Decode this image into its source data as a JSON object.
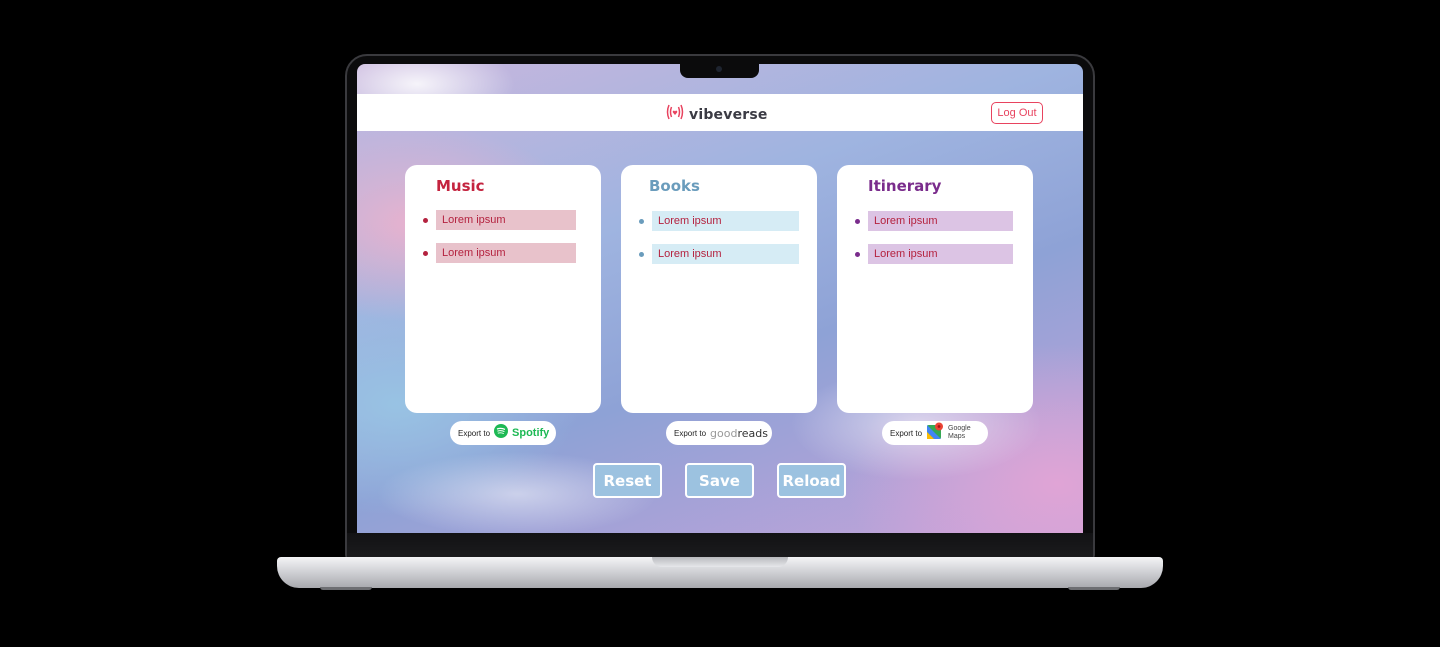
{
  "app": {
    "brand": "vibeverse",
    "logout_label": "Log Out"
  },
  "cards": {
    "music": {
      "title": "Music",
      "items": [
        "Lorem ipsum",
        "Lorem ipsum"
      ]
    },
    "books": {
      "title": "Books",
      "items": [
        "Lorem ipsum",
        "Lorem ipsum"
      ]
    },
    "itinerary": {
      "title": "Itinerary",
      "items": [
        "Lorem ipsum",
        "Lorem ipsum"
      ]
    }
  },
  "exports": {
    "spotify": {
      "label": "Export to",
      "service": "Spotify"
    },
    "goodreads": {
      "label": "Export to",
      "service_light": "good",
      "service_dark": "reads"
    },
    "google_maps": {
      "label": "Export to",
      "service_line1": "Google",
      "service_line2": "Maps"
    }
  },
  "actions": {
    "reset": "Reset",
    "save": "Save",
    "reload": "Reload"
  },
  "colors": {
    "accent": "#e8435f",
    "music": "#c4243f",
    "books": "#6a9cbc",
    "itinerary": "#7a2c8c",
    "action_button": "#9cc2e0"
  }
}
